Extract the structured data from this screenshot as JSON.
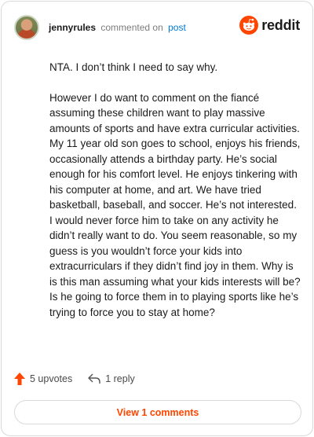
{
  "header": {
    "username": "jennyrules",
    "action_text": "commented on",
    "target_link": "post",
    "brand_name": "reddit"
  },
  "comment": {
    "paragraphs": [
      "NTA. I don’t think I need to say why.",
      "However I do want to comment on the fiancé assuming these children want to play massive amounts of sports and have extra curricular activities. My 11 year old son goes to school, enjoys his friends, occasionally attends a birthday party. He’s social enough for his comfort level. He enjoys tinkering with his computer at home, and art. We have tried basketball, baseball, and soccer. He’s not interested. I would never force him to take on any activity he didn’t really want to do. You seem reasonable, so my guess is you wouldn’t force your kids into extracurriculars if they didn’t find joy in them. Why is is this man assuming what your kids interests will be? Is he going to force them in to playing sports like he’s trying to force you to stay at home?"
    ]
  },
  "actions": {
    "upvotes_label": "5 upvotes",
    "replies_label": "1 reply",
    "view_comments_label": "View 1 comments"
  },
  "colors": {
    "accent": "#ff4500",
    "link": "#0079d3",
    "border": "#d7dadc"
  },
  "icons": {
    "upvote": "upvote-arrow-icon",
    "reply": "reply-icon",
    "brand": "reddit-logo-icon"
  }
}
